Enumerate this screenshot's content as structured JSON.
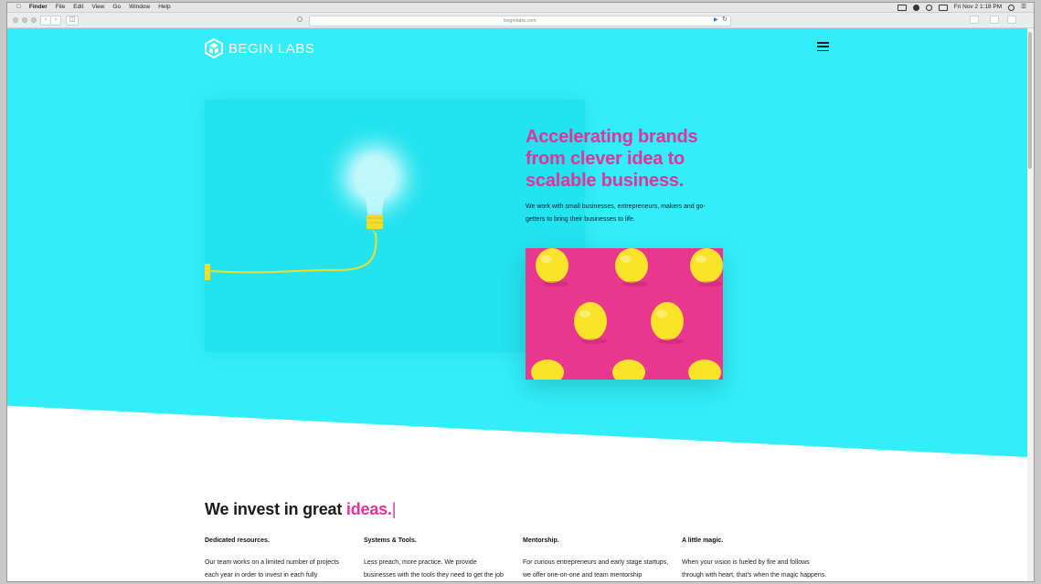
{
  "menubar": {
    "app": "Finder",
    "items": [
      "File",
      "Edit",
      "View",
      "Go",
      "Window",
      "Help"
    ],
    "clock": "Fri Nov 2  1:18 PM"
  },
  "browser": {
    "url": "beginlabs.com"
  },
  "site": {
    "logo_text": "BEGIN LABS",
    "hero": {
      "headline_lines": [
        "Accelerating brands",
        "from clever idea to",
        "scalable business."
      ],
      "subtext": "We work with small businesses, entrepreneurs, makers and go-getters to bring their businesses to life."
    },
    "invest": {
      "title_prefix": "We invest in great ",
      "title_accent": "ideas.",
      "cursor": "|"
    },
    "columns": [
      {
        "title": "Dedicated resources.",
        "text": "Our team works on a limited number of projects each year in order to invest in each fully"
      },
      {
        "title": "Systems & Tools.",
        "text": "Less preach, more practice. We provide businesses with the tools they need to get the job done in the"
      },
      {
        "title": "Mentorship.",
        "text": "For curious entrepreneurs and early stage startups, we offer one-on-one and team mentorship"
      },
      {
        "title": "A little magic.",
        "text": "When your vision is fueled by fire and follows through with heart, that's when the magic happens."
      }
    ]
  },
  "colors": {
    "hero_bg": "#33eef8",
    "accent_pink": "#e0339b",
    "lemon_card": "#e8378f",
    "lemon": "#fbe32a"
  }
}
